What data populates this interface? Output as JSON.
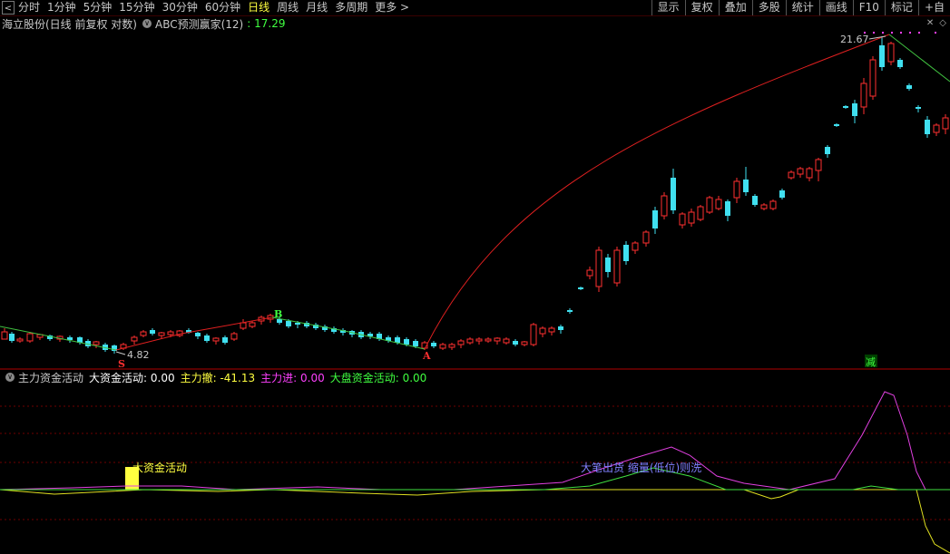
{
  "toolbar": {
    "back": "<",
    "timeframes": [
      "分时",
      "1分钟",
      "5分钟",
      "15分钟",
      "30分钟",
      "60分钟",
      "日线",
      "周线",
      "月线",
      "多周期",
      "更多 >"
    ],
    "active_index": 6,
    "right_buttons": [
      "显示",
      "复权",
      "叠加",
      "多股",
      "统计",
      "画线",
      "F10",
      "标记",
      "+自"
    ]
  },
  "info": {
    "stock": "海立股份(日线 前复权 对数)",
    "indicator_icon": "∨",
    "indicator": "ABC预测赢家(12)",
    "indicator_value": ": 17.29"
  },
  "price_chart": {
    "high_label": "21.67",
    "low_label": "4.82",
    "marker_b": "B",
    "marker_a": "A",
    "marker_s": "S",
    "marker_jian": "减"
  },
  "sub": {
    "name": "主力资金活动",
    "items": [
      {
        "label": "大资金活动: 0.00",
        "color": "#ffffff"
      },
      {
        "label": "主力撤: -41.13",
        "color": "#ffff40"
      },
      {
        "label": "主力进: 0.00",
        "color": "#ff40ff"
      },
      {
        "label": "大盘资金活动: 0.00",
        "color": "#40ff40"
      }
    ],
    "annotation1": "大资金活动",
    "annotation2": "大笔出货 缩量(低位)则洗"
  },
  "colors": {
    "up": "#ff3030",
    "down": "#40e0f0",
    "ma_green": "#40c040",
    "ma_red": "#e02020"
  }
}
